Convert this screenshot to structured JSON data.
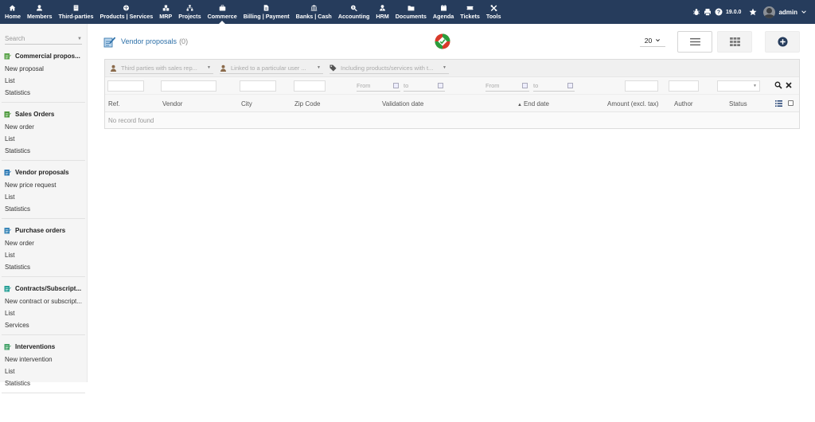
{
  "topnav": {
    "items": [
      {
        "label": "Home",
        "icon": "home-icon"
      },
      {
        "label": "Members",
        "icon": "user-icon"
      },
      {
        "label": "Third-parties",
        "icon": "building-icon"
      },
      {
        "label": "Products | Services",
        "icon": "cube-icon"
      },
      {
        "label": "MRP",
        "icon": "cubes-icon"
      },
      {
        "label": "Projects",
        "icon": "sitemap-icon"
      },
      {
        "label": "Commerce",
        "icon": "briefcase-icon"
      },
      {
        "label": "Billing | Payment",
        "icon": "file-invoice-icon"
      },
      {
        "label": "Banks | Cash",
        "icon": "bank-icon"
      },
      {
        "label": "Accounting",
        "icon": "search-dollar-icon"
      },
      {
        "label": "HRM",
        "icon": "user-tie-icon"
      },
      {
        "label": "Documents",
        "icon": "folder-icon"
      },
      {
        "label": "Agenda",
        "icon": "calendar-icon"
      },
      {
        "label": "Tickets",
        "icon": "ticket-icon"
      },
      {
        "label": "Tools",
        "icon": "tools-icon"
      }
    ],
    "active_index": 6
  },
  "topright": {
    "version": "19.0.0",
    "username": "admin"
  },
  "sidebar": {
    "search_placeholder": "Search",
    "blocks": [
      {
        "title": "Commercial propos...",
        "icon": "commercial-proposal-icon",
        "color": "#5aa34a",
        "links": [
          "New proposal",
          "List",
          "Statistics"
        ]
      },
      {
        "title": "Sales Orders",
        "icon": "sales-order-icon",
        "color": "#4f9a3f",
        "links": [
          "New order",
          "List",
          "Statistics"
        ]
      },
      {
        "title": "Vendor proposals",
        "icon": "vendor-proposal-icon",
        "color": "#2d7ab5",
        "links": [
          "New price request",
          "List",
          "Statistics"
        ]
      },
      {
        "title": "Purchase orders",
        "icon": "purchase-order-icon",
        "color": "#3a87b8",
        "links": [
          "New order",
          "List",
          "Statistics"
        ]
      },
      {
        "title": "Contracts/Subscript...",
        "icon": "contract-icon",
        "color": "#2aa198",
        "links": [
          "New contract or subscript...",
          "List",
          "Services"
        ]
      },
      {
        "title": "Interventions",
        "icon": "intervention-icon",
        "color": "#46a36a",
        "links": [
          "New intervention",
          "List",
          "Statistics"
        ]
      }
    ]
  },
  "main": {
    "title": "Vendor proposals",
    "count": "(0)",
    "per_page": "20",
    "filters": {
      "sales_rep_placeholder": "Third parties with sales rep...",
      "linked_user_placeholder": "Linked to a particular user ...",
      "products_placeholder": "Including products/services with t..."
    },
    "date_from": "From",
    "date_to": "to",
    "columns": [
      "Ref.",
      "Vendor",
      "City",
      "Zip Code",
      "Validation date",
      "End date",
      "Amount (excl. tax)",
      "Author",
      "Status"
    ],
    "no_record": "No record found"
  },
  "colors": {
    "topbar": "#263c5c",
    "title_link": "#2c6fa8",
    "add_button": "#263c5c"
  }
}
